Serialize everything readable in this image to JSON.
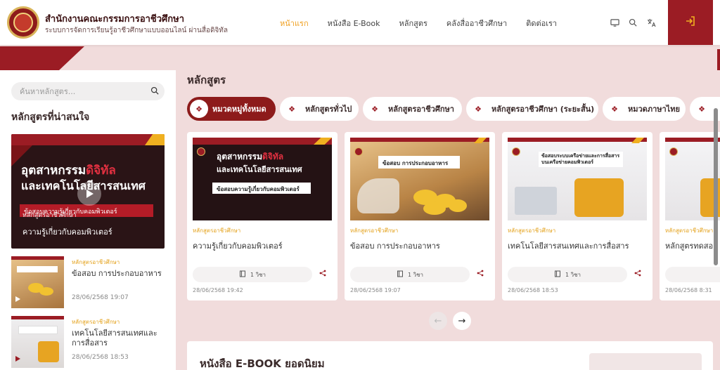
{
  "header": {
    "org_name": "สำนักงานคณะกรรมการอาชีวศึกษา",
    "org_subtitle": "ระบบการจัดการเรียนรู้อาชีวศึกษาแบบออนไลน์ ผ่านสื่อดิจิทัล",
    "nav": [
      "หน้าแรก",
      "หนังสือ E-Book",
      "หลักสูตร",
      "คลังสื่ออาชีวศึกษา",
      "ติดต่อเรา"
    ],
    "active_nav": "หน้าแรก",
    "icons": [
      "monitor-icon",
      "search-icon",
      "translate-icon",
      "login-icon"
    ]
  },
  "sidebar": {
    "search_placeholder": "ค้นหาหลักสูตร...",
    "title": "หลักสูตรที่น่าสนใจ",
    "featured": {
      "banner_line1a": "อุตสาหกรรม",
      "banner_line1b": "ดิจิทัล",
      "banner_line2": "และเทคโนโลยีสารสนเทศ",
      "banner_sub": "ข้อสอบความรู้เกี่ยวกับคอมพิวเตอร์",
      "category": "หลักสูตรอาชีวศึกษา",
      "title": "ความรู้เกี่ยวกับคอมพิวเตอร์"
    },
    "items": [
      {
        "category": "หลักสูตรอาชีวศึกษา",
        "title": "ข้อสอบ การประกอบอาหาร",
        "date": "28/06/2568 19:07"
      },
      {
        "category": "หลักสูตรอาชีวศึกษา",
        "title": "เทคโนโลยีสารสนเทศและการสื่อสาร",
        "date": "28/06/2568 18:53"
      }
    ]
  },
  "main": {
    "title": "หลักสูตร",
    "chips": [
      "หมวดหมู่ทั้งหมด",
      "หลักสูตรทั่วไป",
      "หลักสูตรอาชีวศึกษา",
      "หลักสูตรอาชีวศึกษา (ระยะสั้น)",
      "หมวดภาษาไทย",
      ""
    ],
    "active_chip": "หมวดหมู่ทั้งหมด",
    "cards": [
      {
        "category": "หลักสูตรอาชีวศึกษา",
        "title": "ความรู้เกี่ยวกับคอมพิวเตอร์",
        "subjects": "1 วิชา",
        "date": "28/06/2568 19:42",
        "thumb_l1a": "อุตสาหกรรม",
        "thumb_l1b": "ดิจิทัล",
        "thumb_l2": "และเทคโนโลยีสารสนเทศ",
        "thumb_l3": "ข้อสอบความรู้เกี่ยวกับคอมพิวเตอร์"
      },
      {
        "category": "หลักสูตรอาชีวศึกษา",
        "title": "ข้อสอบ การประกอบอาหาร",
        "subjects": "1 วิชา",
        "date": "28/06/2568 19:07",
        "thumb_l3": "ข้อสอบ การประกอบอาหาร"
      },
      {
        "category": "หลักสูตรอาชีวศึกษา",
        "title": "เทคโนโลยีสารสนเทศและการสื่อสาร",
        "subjects": "1 วิชา",
        "date": "28/06/2568 18:53",
        "thumb_l3": "ข้อสอบระบบเครือข่ายและการสื่อสาร บนเครือข่ายคอมพิวเตอร์"
      },
      {
        "category": "หลักสูตรอาชีวศึกษา",
        "title": "หลักสูตรทดสอ",
        "subjects": "",
        "date": "28/06/2568 8:31"
      }
    ]
  },
  "ebook": {
    "title": "หนังสือ E-BOOK ยอดนิยม"
  },
  "colors": {
    "brand": "#9b1c24",
    "accent": "#f0a020",
    "background": "#f1dcdc"
  }
}
